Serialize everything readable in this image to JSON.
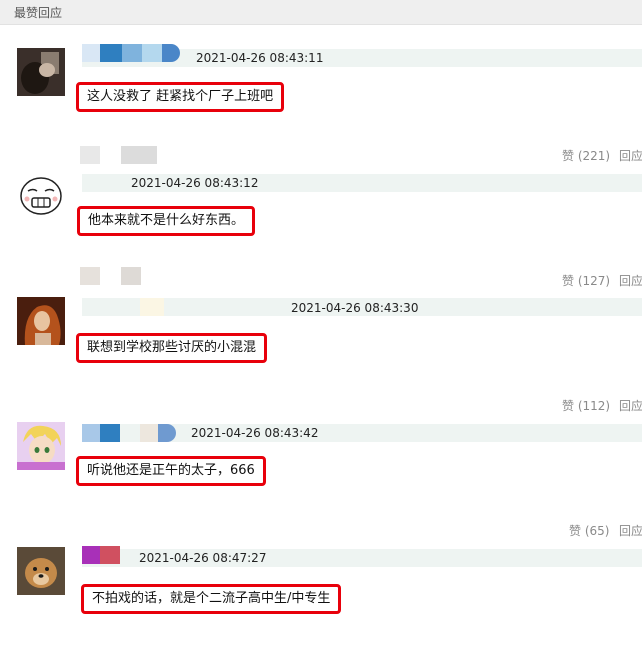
{
  "section_title": "最赞回应",
  "comments": [
    {
      "timestamp": "2021-04-26 08:43:11",
      "content": "这人没救了 赶紧找个厂子上班吧",
      "like_label": "赞 (221)",
      "reply_label": "回应"
    },
    {
      "timestamp": "2021-04-26 08:43:12",
      "content": "他本来就不是什么好东西。",
      "like_label": "赞 (127)",
      "reply_label": "回应"
    },
    {
      "timestamp": "2021-04-26 08:43:30",
      "content": "联想到学校那些讨厌的小混混",
      "like_label": "赞 (112)",
      "reply_label": "回应"
    },
    {
      "timestamp": "2021-04-26 08:43:42",
      "content": "听说他还是正午的太子，666",
      "like_label": "赞 (65)",
      "reply_label": "回应"
    },
    {
      "timestamp": "2021-04-26 08:47:27",
      "content": "不拍戏的话，就是个二流子高中生/中专生"
    }
  ],
  "colors": {
    "highlight_border": "#e8000b",
    "meta_strip": "#eef4f2",
    "action_text": "#8a8a8a"
  }
}
